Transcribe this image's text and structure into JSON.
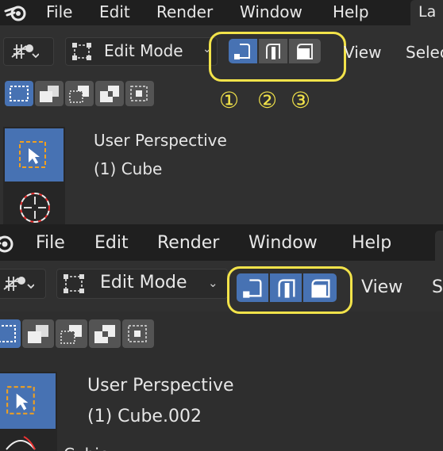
{
  "top": {
    "menu": {
      "file": "File",
      "edit": "Edit",
      "render": "Render",
      "window": "Window",
      "help": "Help",
      "layout_tab": "La"
    },
    "header": {
      "mode": "Edit Mode",
      "view": "View",
      "select": "Selec"
    },
    "annotations": [
      "①",
      "②",
      "③"
    ],
    "viewport": {
      "perspective": "User Perspective",
      "object": "(1) Cube"
    }
  },
  "bottom": {
    "menu": {
      "file": "File",
      "edit": "Edit",
      "render": "Render",
      "window": "Window",
      "help": "Help"
    },
    "header": {
      "mode": "Edit Mode",
      "view": "View",
      "select": "S"
    },
    "viewport": {
      "perspective": "User Perspective",
      "object": "(1) Cube.002",
      "partial_label": "Cubic"
    }
  },
  "colors": {
    "accent": "#4772b3",
    "highlight": "#f2e34a",
    "menubar": "#1f1f1f",
    "background": "#303030"
  },
  "icons": [
    "blender-logo-icon",
    "transform-pivot-icon",
    "edit-mode-icon",
    "vertex-select-icon",
    "edge-select-icon",
    "face-select-icon",
    "select-box-icon",
    "select-extend-icon",
    "select-subtract-icon",
    "select-invert-icon",
    "select-intersect-icon",
    "cursor-select-icon",
    "3d-cursor-icon"
  ]
}
